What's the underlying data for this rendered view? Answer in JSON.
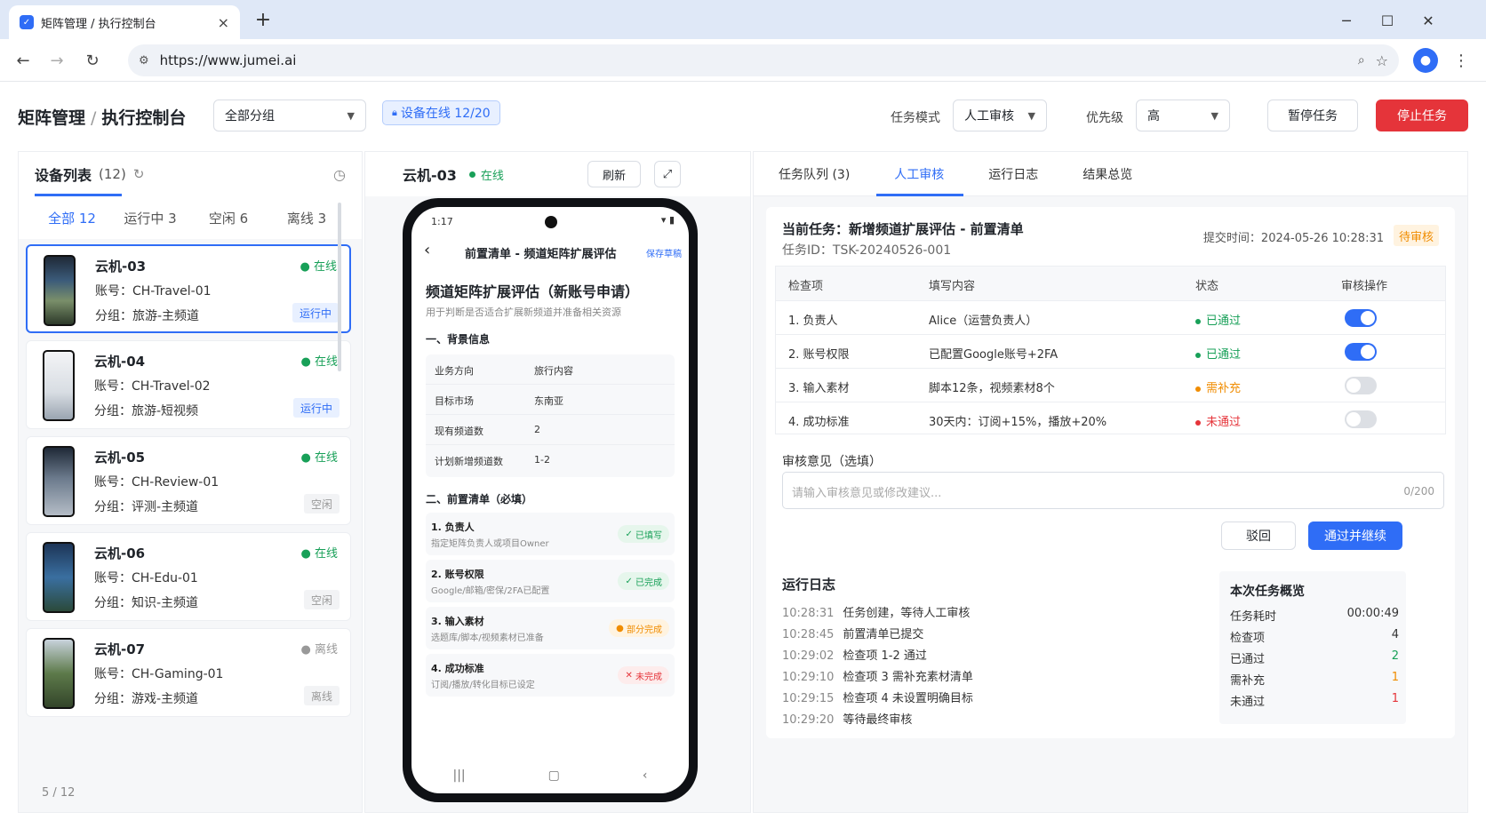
{
  "browser": {
    "tab_title": "矩阵管理 / 执行控制台",
    "tab_close": "×",
    "new_tab": "+",
    "url": "https://www.jumei.ai"
  },
  "header": {
    "crumb_root": "矩阵管理",
    "crumb_sep": "/",
    "crumb_page": "执行控制台",
    "group_select": "全部分组",
    "online_badge": "设备在线 12/20",
    "mode_label": "任务模式",
    "mode_value": "人工审核",
    "priority_label": "优先级",
    "priority_value": "高",
    "pause_btn": "暂停任务",
    "stop_btn": "停止任务"
  },
  "devices": {
    "title": "设备列表",
    "count": "(12)",
    "filters": [
      "全部 12",
      "运行中 3",
      "空闲 6",
      "离线 3"
    ],
    "items": [
      {
        "name": "云机-03",
        "status": "在线",
        "account": "账号：CH-Travel-01",
        "group": "分组：旅游-主频道",
        "tag": "运行中"
      },
      {
        "name": "云机-04",
        "status": "在线",
        "account": "账号：CH-Travel-02",
        "group": "分组：旅游-短视频",
        "tag": "运行中"
      },
      {
        "name": "云机-05",
        "status": "在线",
        "account": "账号：CH-Review-01",
        "group": "分组：评测-主频道",
        "tag": "空闲"
      },
      {
        "name": "云机-06",
        "status": "在线",
        "account": "账号：CH-Edu-01",
        "group": "分组：知识-主频道",
        "tag": "空闲"
      },
      {
        "name": "云机-07",
        "status": "离线",
        "account": "账号：CH-Gaming-01",
        "group": "分组：游戏-主频道",
        "tag": "离线"
      }
    ],
    "pager": "5 / 12"
  },
  "preview": {
    "device": "云机-03",
    "status": "在线",
    "refresh": "刷新",
    "phone": {
      "time": "1:17",
      "title": "前置清单 - 频道矩阵扩展评估",
      "save": "保存草稿",
      "h1": "频道矩阵扩展评估（新账号申请）",
      "sub": "用于判断是否适合扩展新频道并准备相关资源",
      "sec1": "一、背景信息",
      "rows": [
        {
          "k": "业务方向",
          "v": "旅行内容"
        },
        {
          "k": "目标市场",
          "v": "东南亚"
        },
        {
          "k": "现有频道数",
          "v": "2"
        },
        {
          "k": "计划新增频道数",
          "v": "1-2"
        }
      ],
      "sec2": "二、前置清单（必填）",
      "items": [
        {
          "t": "1. 负责人",
          "d": "指定矩阵负责人或项目Owner",
          "b": "已填写"
        },
        {
          "t": "2. 账号权限",
          "d": "Google/邮箱/密保/2FA已配置",
          "b": "已完成"
        },
        {
          "t": "3. 输入素材",
          "d": "选题库/脚本/视频素材已准备",
          "b": "部分完成"
        },
        {
          "t": "4. 成功标准",
          "d": "订阅/播放/转化目标已设定",
          "b": "未完成"
        }
      ]
    }
  },
  "right": {
    "tabs": [
      "任务队列 (3)",
      "人工审核",
      "运行日志",
      "结果总览"
    ],
    "review": {
      "title": "当前任务：新增频道扩展评估 - 前置清单",
      "task_id": "任务ID：TSK-20240526-001",
      "submit_time": "提交时间：2024-05-26 10:28:31",
      "state": "待审核",
      "headers": [
        "检查项",
        "填写内容",
        "状态",
        "审核操作"
      ],
      "rows": [
        {
          "item": "1. 负责人",
          "content": "Alice（运营负责人）",
          "status": "已通过",
          "color": "#18a058",
          "on": true
        },
        {
          "item": "2. 账号权限",
          "content": "已配置Google账号+2FA",
          "status": "已通过",
          "color": "#18a058",
          "on": true
        },
        {
          "item": "3. 输入素材",
          "content": "脚本12条，视频素材8个",
          "status": "需补充",
          "color": "#f08c00",
          "on": false
        },
        {
          "item": "4. 成功标准",
          "content": "30天内：订阅+15%，播放+20%",
          "status": "未通过",
          "color": "#e5343a",
          "on": false
        }
      ],
      "opinion_label": "审核意见（选填）",
      "opinion_placeholder": "请输入审核意见或修改建议...",
      "opinion_count": "0/200",
      "reject": "驳回",
      "approve": "通过并继续"
    },
    "log": {
      "title": "运行日志",
      "lines": [
        {
          "t": "10:28:31",
          "m": "任务创建，等待人工审核"
        },
        {
          "t": "10:28:45",
          "m": "前置清单已提交"
        },
        {
          "t": "10:29:02",
          "m": "检查项 1-2 通过"
        },
        {
          "t": "10:29:10",
          "m": "检查项 3 需补充素材清单"
        },
        {
          "t": "10:29:15",
          "m": "检查项 4 未设置明确目标"
        },
        {
          "t": "10:29:20",
          "m": "等待最终审核"
        }
      ]
    },
    "summary": {
      "title": "本次任务概览",
      "rows": [
        {
          "k": "任务耗时",
          "v": "00:00:49",
          "c": "#1f2329"
        },
        {
          "k": "检查项",
          "v": "4",
          "c": "#1f2329"
        },
        {
          "k": "已通过",
          "v": "2",
          "c": "#18a058"
        },
        {
          "k": "需补充",
          "v": "1",
          "c": "#f08c00"
        },
        {
          "k": "未通过",
          "v": "1",
          "c": "#e5343a"
        }
      ]
    }
  }
}
